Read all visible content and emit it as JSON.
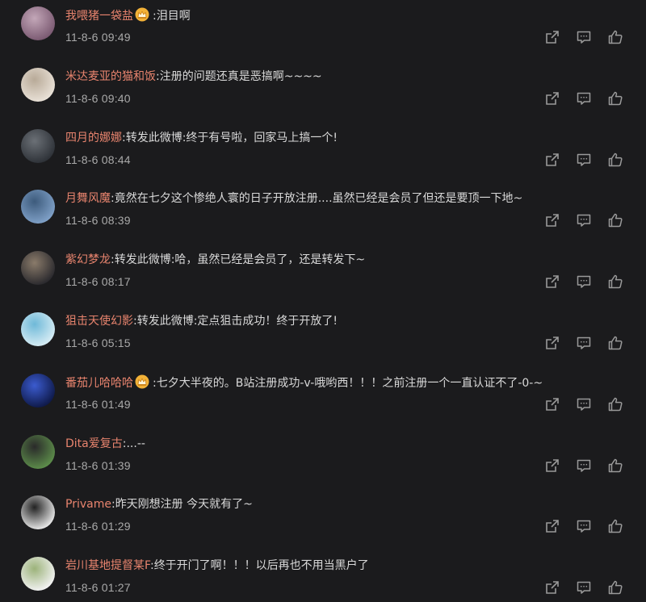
{
  "comments": [
    {
      "username": "我喂猪一袋盐",
      "crown": true,
      "separator": ":",
      "text": "泪目啊",
      "time": "11-8-6 09:49",
      "avatar_colors": [
        "#7b5a72",
        "#c3a7b8"
      ]
    },
    {
      "username": "米达麦亚的猫和饭",
      "crown": false,
      "separator": ":",
      "text": "注册的问题还真是恶搞啊~~~~",
      "time": "11-8-6 09:40",
      "avatar_colors": [
        "#e9e1d7",
        "#b8aa98"
      ]
    },
    {
      "username": "四月的娜娜",
      "crown": false,
      "separator": ":",
      "text": "转发此微博:终于有号啦，回家马上搞一个!",
      "time": "11-8-6 08:44",
      "avatar_colors": [
        "#2e3238",
        "#6b7076"
      ]
    },
    {
      "username": "月舞风魔",
      "crown": false,
      "separator": ":",
      "text": "竟然在七夕这个惨绝人寰的日子开放注册....虽然已经是会员了但还是要顶一下地~",
      "time": "11-8-6 08:39",
      "avatar_colors": [
        "#7fa0c7",
        "#3d5b7c"
      ]
    },
    {
      "username": "紫幻梦龙",
      "crown": false,
      "separator": ":",
      "text": "转发此微博:哈，虽然已经是会员了，还是转发下~",
      "time": "11-8-6 08:17",
      "avatar_colors": [
        "#2b2a2e",
        "#8a7b6a"
      ]
    },
    {
      "username": "狙击天使幻影",
      "crown": false,
      "separator": ":",
      "text": "转发此微博:定点狙击成功！终于开放了!",
      "time": "11-8-6 05:15",
      "avatar_colors": [
        "#d6ecf4",
        "#6fb9d8"
      ]
    },
    {
      "username": "番茄儿哈哈哈",
      "crown": true,
      "separator": ":",
      "text": "七夕大半夜的。B站注册成功-v-哦哟西！！！之前注册一个一直认证不了-0-~",
      "time": "11-8-6 01:49",
      "avatar_colors": [
        "#0f1a4a",
        "#3b5bcf"
      ]
    },
    {
      "username": "Dita爱复古",
      "crown": false,
      "separator": ":",
      "text": "...--",
      "time": "11-8-6 01:39",
      "avatar_colors": [
        "#5c8c4a",
        "#2a2a2a"
      ]
    },
    {
      "username": "Privame",
      "crown": false,
      "separator": ":",
      "text": "昨天刚想注册 今天就有了~",
      "time": "11-8-6 01:29",
      "avatar_colors": [
        "#e6e6e6",
        "#222222"
      ]
    },
    {
      "username": "岩川基地提督某F",
      "crown": false,
      "separator": ":",
      "text": "终于开门了啊！！！以后再也不用当黑户了",
      "time": "11-8-6 01:27",
      "avatar_colors": [
        "#f2f2f2",
        "#9cb37a"
      ]
    }
  ],
  "actions": [
    "share-icon",
    "reply-icon",
    "like-icon"
  ],
  "colors": {
    "background": "#1b1b1d",
    "username": "#e8846e",
    "text": "#d9d9d9",
    "timestamp": "#a9a9a9",
    "icon": "#9a9a9a"
  }
}
